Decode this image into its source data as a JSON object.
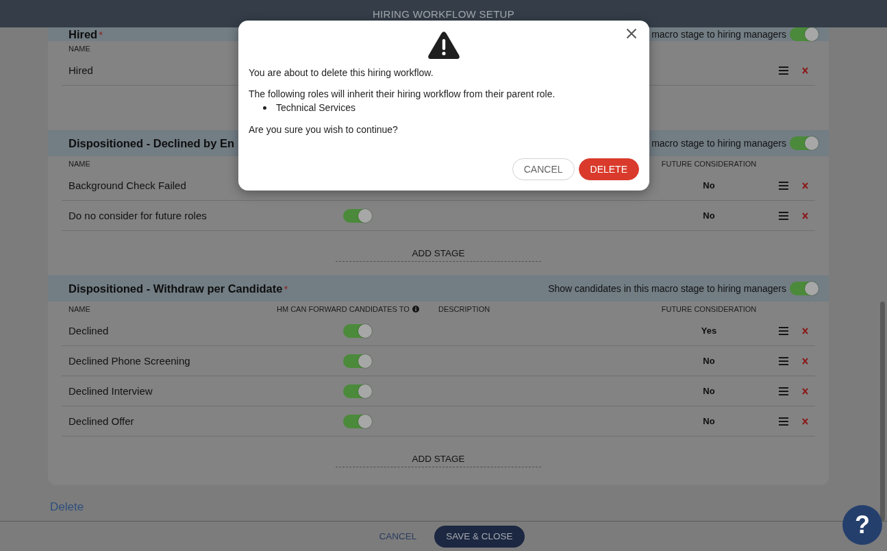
{
  "header": {
    "title": "HIRING WORKFLOW SETUP"
  },
  "sections": [
    {
      "title": "Hired",
      "required_mark": "*",
      "visibility_label": "macro stage to hiring managers",
      "visibility_on": true,
      "columns": [
        {
          "kind": "name",
          "label": "NAME"
        }
      ],
      "stages": [
        {
          "name": "Hired"
        }
      ]
    },
    {
      "title": "Dispositioned - Declined by En",
      "visibility_label": "macro stage to hiring managers",
      "visibility_on": true,
      "columns": [
        {
          "kind": "name",
          "label": "NAME"
        },
        {
          "kind": "future",
          "label": "FUTURE CONSIDERATION"
        }
      ],
      "stages": [
        {
          "name": "Background Check Failed",
          "future": "No"
        },
        {
          "name": "Do no consider for future roles",
          "forward": true,
          "future": "No"
        }
      ],
      "add_stage": "ADD STAGE"
    },
    {
      "title": "Dispositioned - Withdraw per Candidate",
      "required_mark": "*",
      "visibility_label": "Show candidates in this macro stage to hiring managers",
      "visibility_on": true,
      "columns": [
        {
          "kind": "name",
          "label": "NAME"
        },
        {
          "kind": "forward",
          "label": "HM CAN FORWARD CANDIDATES TO"
        },
        {
          "kind": "description",
          "label": "DESCRIPTION"
        },
        {
          "kind": "future",
          "label": "FUTURE CONSIDERATION"
        }
      ],
      "stages": [
        {
          "name": "Declined",
          "forward": true,
          "future": "Yes"
        },
        {
          "name": "Declined Phone Screening",
          "forward": true,
          "future": "No"
        },
        {
          "name": "Declined Interview",
          "forward": true,
          "future": "No"
        },
        {
          "name": "Declined Offer",
          "forward": true,
          "future": "No"
        }
      ],
      "add_stage": "ADD STAGE"
    }
  ],
  "delete_link": "Delete",
  "footer": {
    "buttons": [
      {
        "kind": "secondary",
        "label": "CANCEL"
      },
      {
        "kind": "primary",
        "label": "SAVE & CLOSE"
      }
    ]
  },
  "help_button": {
    "label": "?"
  },
  "dialog": {
    "message": "You are about to delete this hiring workflow.",
    "inherit_note": "The following roles will inherit their hiring workflow from their parent role.",
    "roles": [
      "Technical Services"
    ],
    "question": "Are you sure you wish to continue?",
    "buttons": [
      {
        "kind": "secondary",
        "label": "CANCEL"
      },
      {
        "kind": "danger",
        "label": "DELETE"
      }
    ]
  }
}
